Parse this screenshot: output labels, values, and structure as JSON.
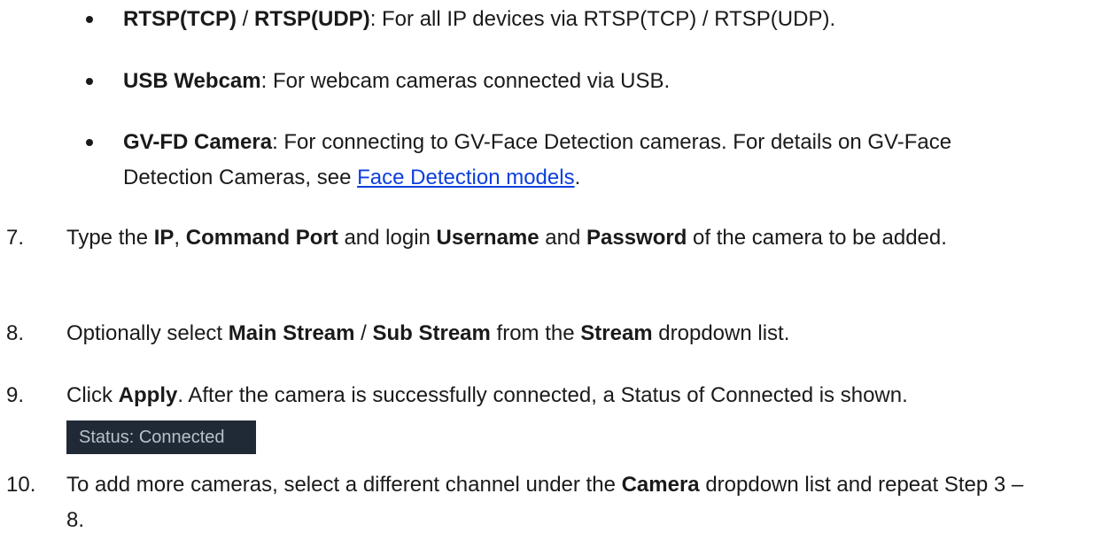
{
  "bullets": [
    {
      "bold1": "RTSP(TCP)",
      "sep": " / ",
      "bold2": "RTSP(UDP)",
      "rest": ": For all IP devices via RTSP(TCP) / RTSP(UDP)."
    },
    {
      "bold": "USB Webcam",
      "rest": ": For webcam cameras connected via USB."
    },
    {
      "bold": "GV-FD Camera",
      "rest": ": For connecting to GV-Face Detection cameras. For details on GV-Face Detection Cameras, see ",
      "link": "Face Detection models",
      "end": "."
    }
  ],
  "steps": {
    "s7": {
      "num": "7.",
      "t1": "Type the ",
      "b1": "IP",
      "t2": ", ",
      "b2": "Command Port",
      "t3": " and login ",
      "b3": "Username",
      "t4": " and ",
      "b4": "Password",
      "t5": " of the camera to be added."
    },
    "s8": {
      "num": "8.",
      "t1": "Optionally select ",
      "b1": "Main Stream",
      "t2": " / ",
      "b2": "Sub Stream",
      "t3": " from the ",
      "b3": "Stream",
      "t4": " dropdown list."
    },
    "s9": {
      "num": "9.",
      "t1": "Click ",
      "b1": "Apply",
      "t2": ". After the camera is successfully connected, a Status of Connected is shown."
    },
    "s10": {
      "num": "10.",
      "t1": "To add more cameras, select a different channel under the ",
      "b1": "Camera",
      "t2": " dropdown list and repeat Step 3 – 8."
    }
  },
  "status_box": {
    "text": "Status: Connected"
  },
  "colors": {
    "link": "#0b3fdc",
    "status_bg": "#1f2a36",
    "status_text": "#b9c1c9"
  }
}
